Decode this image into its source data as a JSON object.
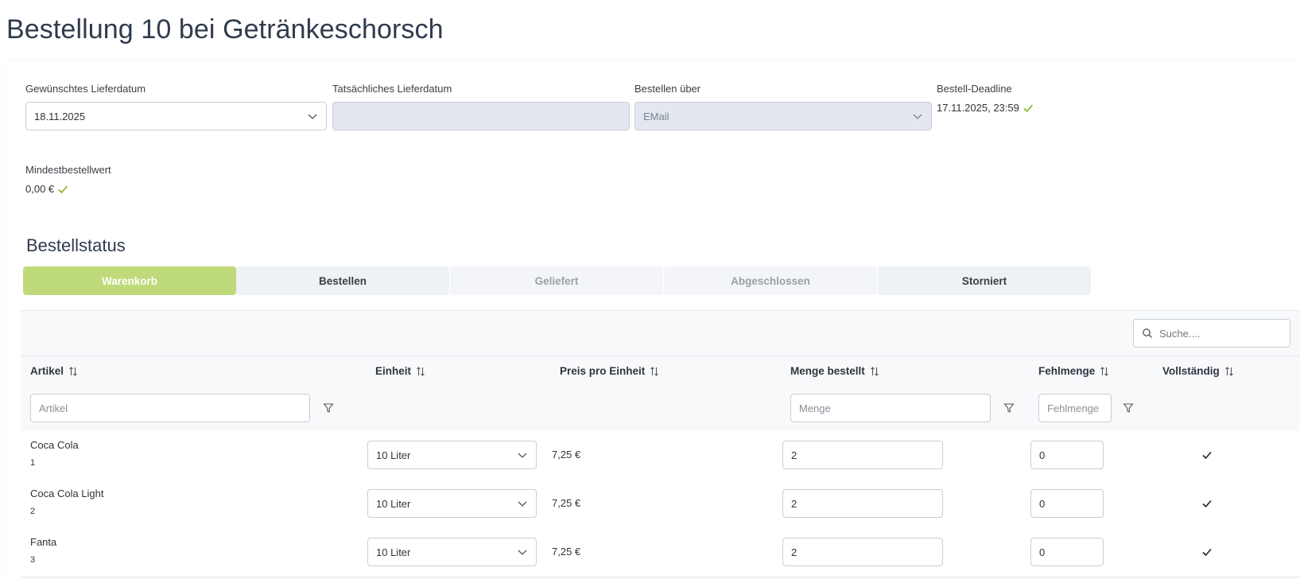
{
  "page": {
    "title": "Bestellung 10 bei Getränkeschorsch"
  },
  "form": {
    "desired_date": {
      "label": "Gewünschtes Lieferdatum",
      "value": "18.11.2025"
    },
    "actual_date": {
      "label": "Tatsächliches Lieferdatum",
      "value": ""
    },
    "order_via": {
      "label": "Bestellen über",
      "value": "EMail"
    },
    "deadline": {
      "label": "Bestell-Deadline",
      "value": "17.11.2025, 23:59",
      "ok": true
    },
    "min_order": {
      "label": "Mindestbestellwert",
      "value": "0,00 €",
      "ok": true
    }
  },
  "status": {
    "title": "Bestellstatus",
    "buttons": [
      {
        "label": "Warenkorb",
        "state": "active"
      },
      {
        "label": "Bestellen",
        "state": "enabled"
      },
      {
        "label": "Geliefert",
        "state": "disabled"
      },
      {
        "label": "Abgeschlossen",
        "state": "disabled"
      },
      {
        "label": "Storniert",
        "state": "enabled"
      }
    ]
  },
  "table": {
    "search_placeholder": "Suche....",
    "columns": [
      "Artikel",
      "Einheit",
      "Preis pro Einheit",
      "Menge bestellt",
      "Fehlmenge",
      "Vollständig"
    ],
    "filters": {
      "artikel": "Artikel",
      "menge": "Menge",
      "fehlmenge": "Fehlmenge"
    },
    "rows": [
      {
        "name": "Coca Cola",
        "id": "1",
        "unit": "10 Liter",
        "price": "7,25 €",
        "qty": "2",
        "missing": "0",
        "complete": true
      },
      {
        "name": "Coca Cola Light",
        "id": "2",
        "unit": "10 Liter",
        "price": "7,25 €",
        "qty": "2",
        "missing": "0",
        "complete": true
      },
      {
        "name": "Fanta",
        "id": "3",
        "unit": "10 Liter",
        "price": "7,25 €",
        "qty": "2",
        "missing": "0",
        "complete": true
      }
    ]
  },
  "colors": {
    "accent_green": "#bfda7a",
    "check_green": "#7cb518",
    "disabled_field": "#e3e8f0"
  },
  "icons": {
    "dropdown": "chevron-down-icon",
    "ok": "check-icon",
    "search": "search-icon",
    "filter": "filter-icon",
    "sort": "sort-icon"
  }
}
